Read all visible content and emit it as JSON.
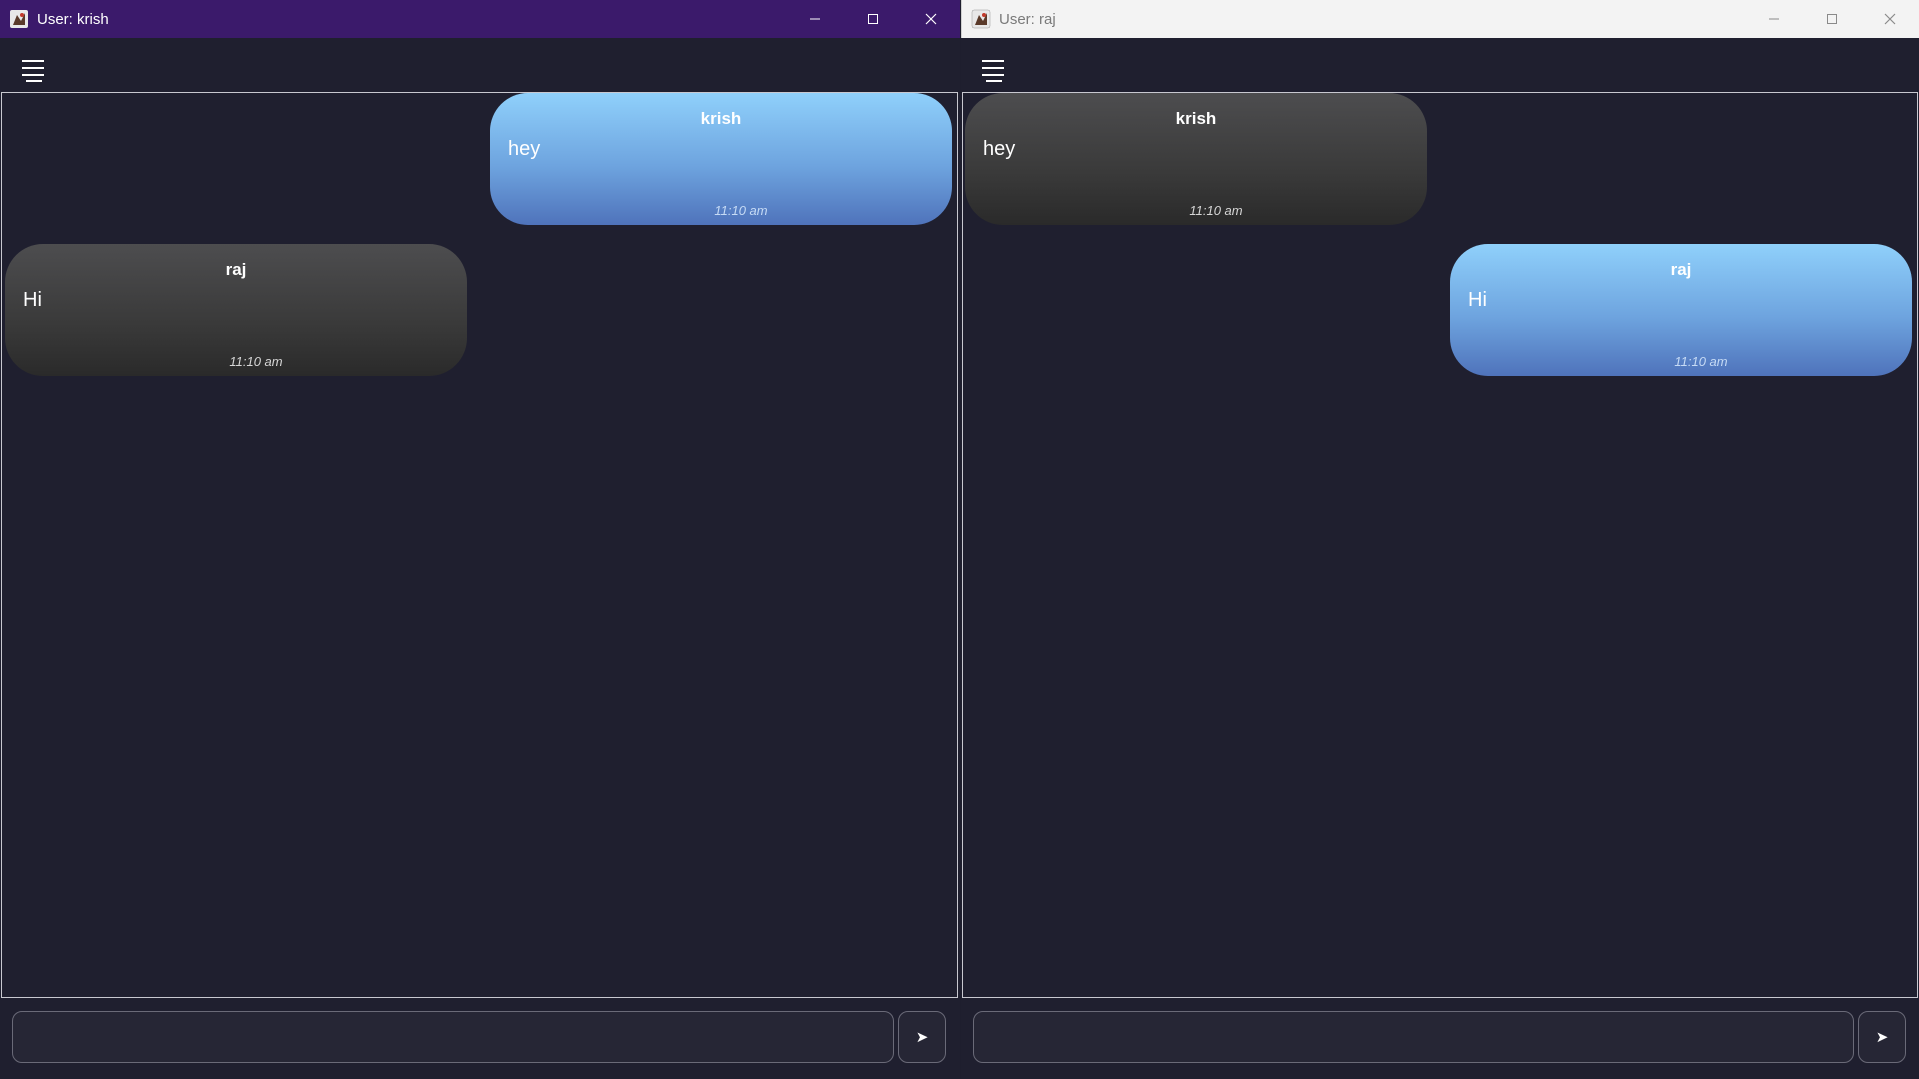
{
  "windows": [
    {
      "title": "User: krish",
      "titlebar_color": "#3b1a6b",
      "messages": [
        {
          "sender": "krish",
          "text": "hey",
          "time": "11:10 am",
          "own": true
        },
        {
          "sender": "raj",
          "text": "Hi",
          "time": "11:10 am",
          "own": false
        }
      ],
      "input": {
        "value": "",
        "placeholder": ""
      },
      "send_icon": "➤"
    },
    {
      "title": "User: raj",
      "titlebar_color": "#f3f3f3",
      "messages": [
        {
          "sender": "krish",
          "text": "hey",
          "time": "11:10 am",
          "own": false
        },
        {
          "sender": "raj",
          "text": "Hi",
          "time": "11:10 am",
          "own": true
        }
      ],
      "input": {
        "value": "",
        "placeholder": ""
      },
      "send_icon": "➤"
    }
  ],
  "icons": {
    "app": "app-icon",
    "menu": "hamburger-menu-icon",
    "minimize": "minimize-icon",
    "maximize": "maximize-icon",
    "close": "close-icon",
    "send": "send-icon"
  },
  "colors": {
    "own_bubble_top": "#8fd0fb",
    "own_bubble_bottom": "#4f73bb",
    "other_bubble_top": "#4d4d4f",
    "other_bubble_bottom": "#2a2a2a",
    "background": "#1f1f2f"
  }
}
